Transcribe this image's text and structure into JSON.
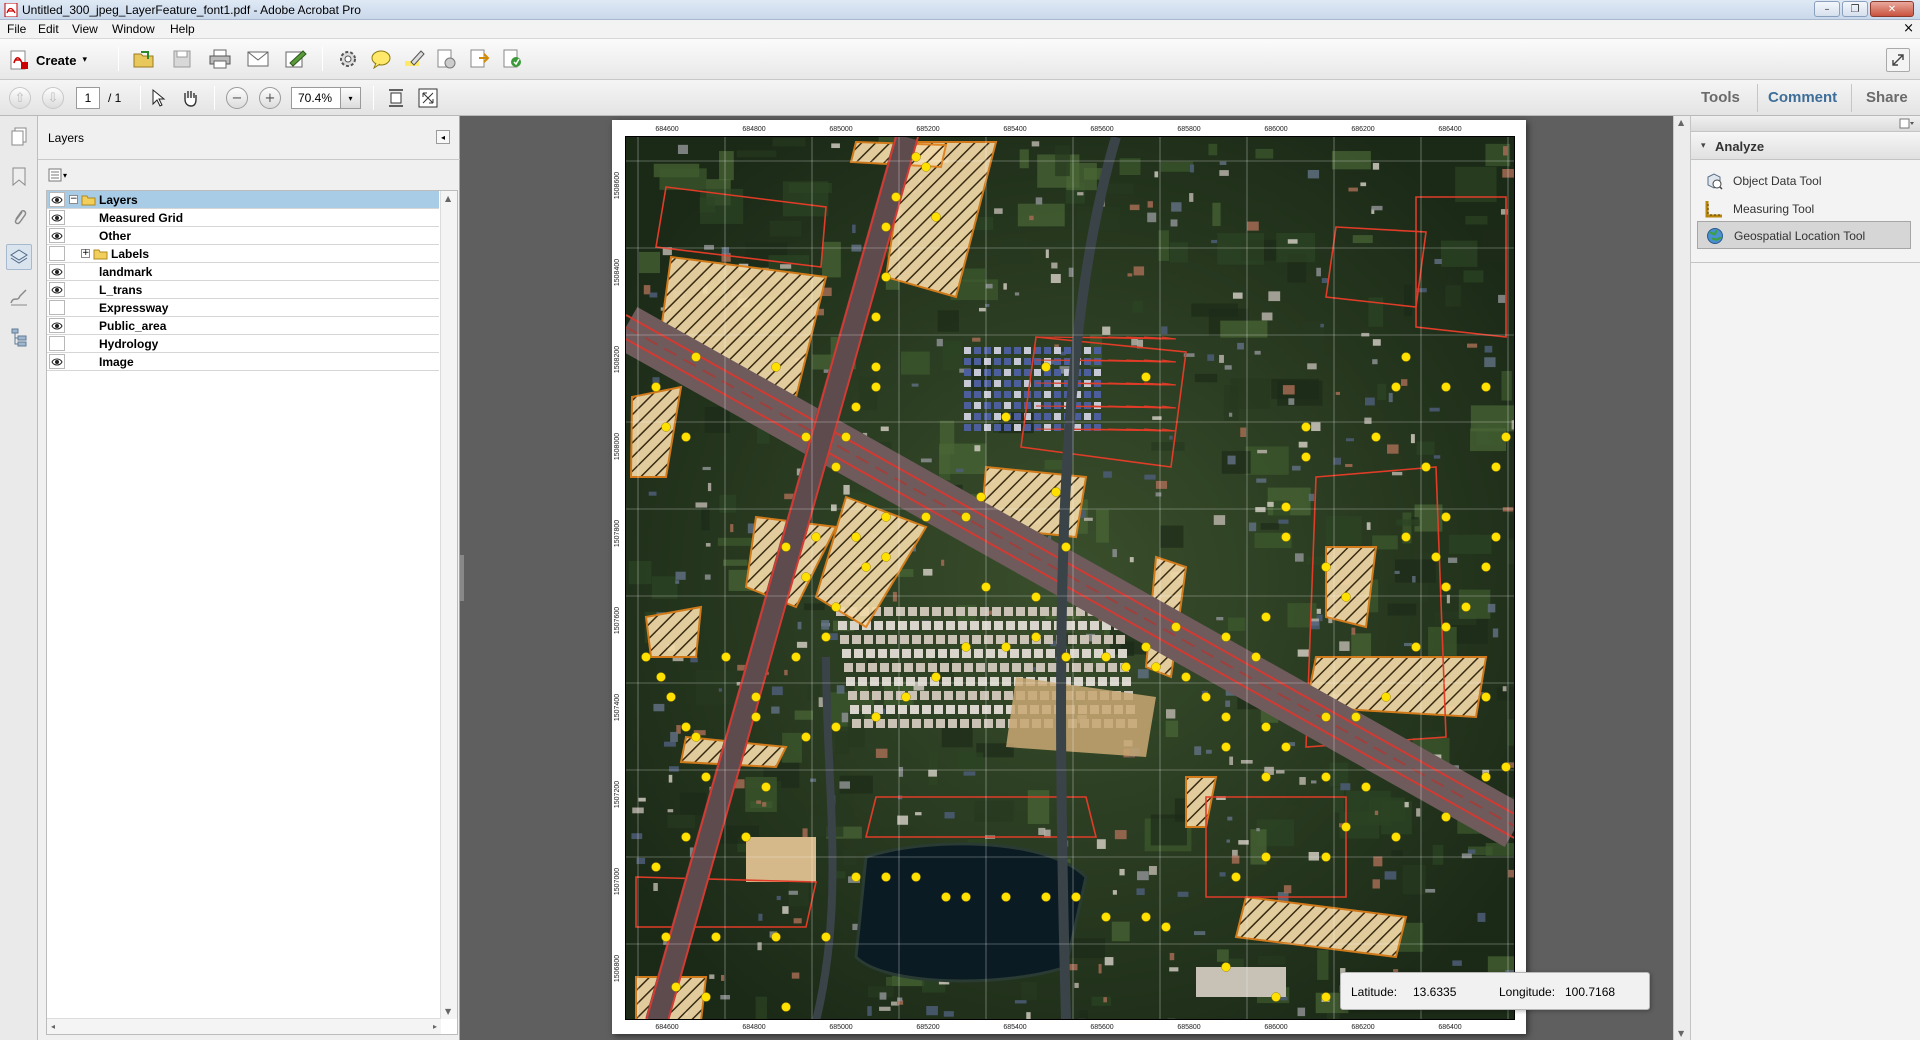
{
  "window": {
    "title": "Untitled_300_jpeg_LayerFeature_font1.pdf - Adobe Acrobat Pro",
    "minimize": "–",
    "restore": "❐",
    "close": "✕"
  },
  "menu": {
    "items": [
      "File",
      "Edit",
      "View",
      "Window",
      "Help"
    ],
    "close_glyph": "×"
  },
  "toolbar": {
    "create_label": "Create",
    "create_arrow": "▾",
    "icons": [
      "open-icon",
      "save-icon",
      "print-icon",
      "email-icon",
      "sign-icon",
      "settings-icon",
      "comment-icon",
      "highlight-icon",
      "export-icon",
      "edit-pdf-icon",
      "create-pdf-icon"
    ]
  },
  "nav": {
    "page_current": "1",
    "page_total": "/ 1",
    "zoom": "70.4%",
    "zoom_arrow": "▾",
    "prev_glyph": "⇧",
    "next_glyph": "⇩",
    "zoom_out_glyph": "−",
    "zoom_in_glyph": "+"
  },
  "right_tabs": {
    "tools": "Tools",
    "comment": "Comment",
    "share": "Share"
  },
  "layers_panel": {
    "title": "Layers",
    "collapse_glyph": "◂",
    "options_arrow": "▾",
    "rows": [
      {
        "label": "Layers",
        "visible": true,
        "expander": "−",
        "folder": true,
        "indent": 0
      },
      {
        "label": "Measured Grid",
        "visible": true,
        "indent": 1
      },
      {
        "label": "Other",
        "visible": true,
        "indent": 1
      },
      {
        "label": "Labels",
        "visible": false,
        "expander": "+",
        "folder": true,
        "indent": 1
      },
      {
        "label": "landmark",
        "visible": true,
        "indent": 1
      },
      {
        "label": "L_trans",
        "visible": true,
        "indent": 1
      },
      {
        "label": "Expressway",
        "visible": false,
        "indent": 1
      },
      {
        "label": "Public_area",
        "visible": true,
        "indent": 1
      },
      {
        "label": "Hydrology",
        "visible": false,
        "indent": 1
      },
      {
        "label": "Image",
        "visible": true,
        "indent": 1
      }
    ],
    "scroll_up": "▲",
    "scroll_down": "▼",
    "scroll_left": "◂",
    "scroll_right": "▸"
  },
  "map": {
    "eastings": [
      "684600",
      "684800",
      "685000",
      "685200",
      "685400",
      "685600",
      "685800",
      "686000",
      "686200",
      "686400"
    ],
    "northings": [
      "1508600",
      "1508400",
      "1508200",
      "1508000",
      "1507800",
      "1507600",
      "1507400",
      "1507200",
      "1507000",
      "1506800"
    ]
  },
  "geo_tooltip": {
    "latitude_label": "Latitude:",
    "latitude_value": "13.6335",
    "longitude_label": "Longitude:",
    "longitude_value": "100.7168"
  },
  "tools_panel": {
    "section": "Analyze",
    "section_arrow": "▾",
    "items": [
      {
        "label": "Object Data Tool",
        "selected": false
      },
      {
        "label": "Measuring Tool",
        "selected": false
      },
      {
        "label": "Geospatial Location Tool",
        "selected": true
      }
    ]
  },
  "colors": {
    "accent_blue": "#3e6e98",
    "selection": "#a8cbe6",
    "doc_background": "#5f5f5f",
    "map_marker": "#ffe000",
    "parcel_outline": "#e03c28"
  }
}
